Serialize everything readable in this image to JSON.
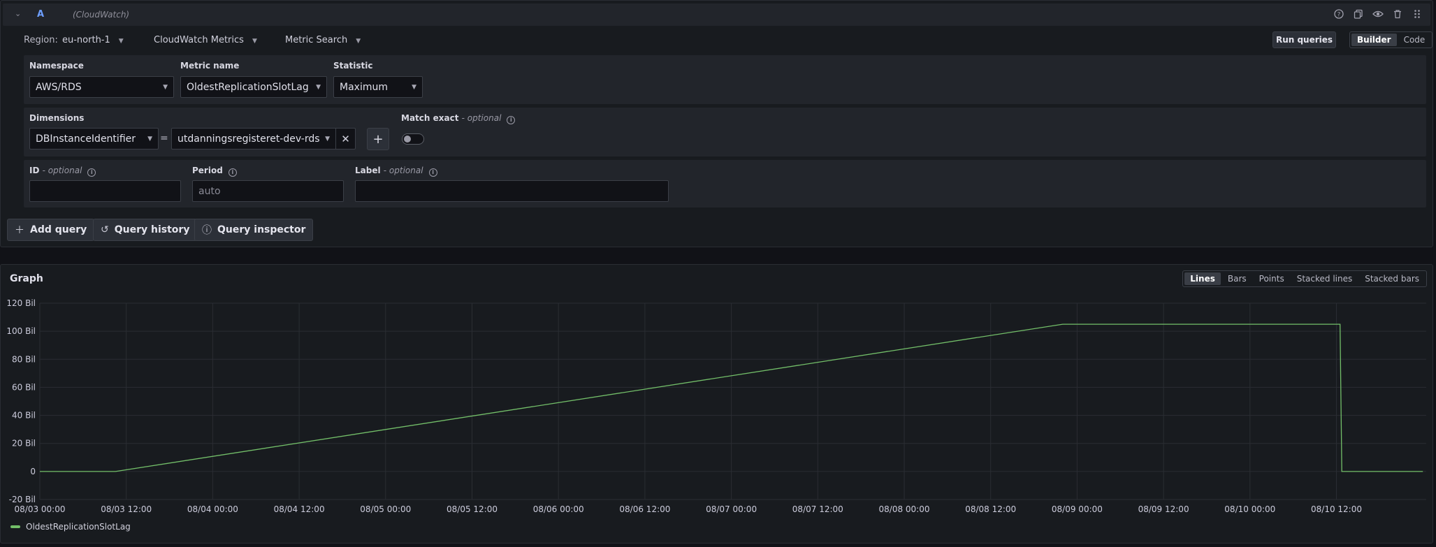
{
  "query": {
    "id": "A",
    "datasource": "(CloudWatch)",
    "region_label": "Region:",
    "region_value": "eu-north-1",
    "service": "CloudWatch Metrics",
    "mode": "Metric Search",
    "run_label": "Run queries",
    "editor_modes": [
      "Builder",
      "Code"
    ],
    "active_editor_mode": "Builder",
    "namespace_label": "Namespace",
    "namespace_value": "AWS/RDS",
    "metric_label": "Metric name",
    "metric_value": "OldestReplicationSlotLag",
    "statistic_label": "Statistic",
    "statistic_value": "Maximum",
    "dimensions_label": "Dimensions",
    "dimension_key": "DBInstanceIdentifier",
    "dimension_op": "=",
    "dimension_value": "utdanningsregisteret-dev-rds",
    "match_exact_label": "Match exact",
    "optional_text": "- optional",
    "id_label": "ID",
    "period_label": "Period",
    "period_placeholder": "auto",
    "label_label": "Label"
  },
  "actions": {
    "add_query": "Add query",
    "query_history": "Query history",
    "query_inspector": "Query inspector"
  },
  "graph": {
    "title": "Graph",
    "modes": [
      "Lines",
      "Bars",
      "Points",
      "Stacked lines",
      "Stacked bars"
    ],
    "active_mode": "Lines"
  },
  "chart_data": {
    "type": "line",
    "y_ticks": [
      "120 Bil",
      "100 Bil",
      "80 Bil",
      "60 Bil",
      "40 Bil",
      "20 Bil",
      "0",
      "-20 Bil"
    ],
    "ylim": [
      -20,
      120
    ],
    "y_unit": "Bil",
    "x_ticks": [
      "08/03 00:00",
      "08/03 12:00",
      "08/04 00:00",
      "08/04 12:00",
      "08/05 00:00",
      "08/05 12:00",
      "08/06 00:00",
      "08/06 12:00",
      "08/07 00:00",
      "08/07 12:00",
      "08/08 00:00",
      "08/08 12:00",
      "08/09 00:00",
      "08/09 12:00",
      "08/10 00:00",
      "08/10 12:00"
    ],
    "series": [
      {
        "name": "OldestReplicationSlotLag",
        "color": "#73bf69",
        "points": [
          {
            "x": "08/03 00:00",
            "y": 0
          },
          {
            "x": "08/03 10:30",
            "y": 0
          },
          {
            "x": "08/08 22:00",
            "y": 105
          },
          {
            "x": "08/10 12:30",
            "y": 105
          },
          {
            "x": "08/10 12:45",
            "y": 0
          },
          {
            "x": "08/11 00:00",
            "y": 0
          }
        ]
      }
    ],
    "grid": true,
    "legend": "bottom-left"
  }
}
